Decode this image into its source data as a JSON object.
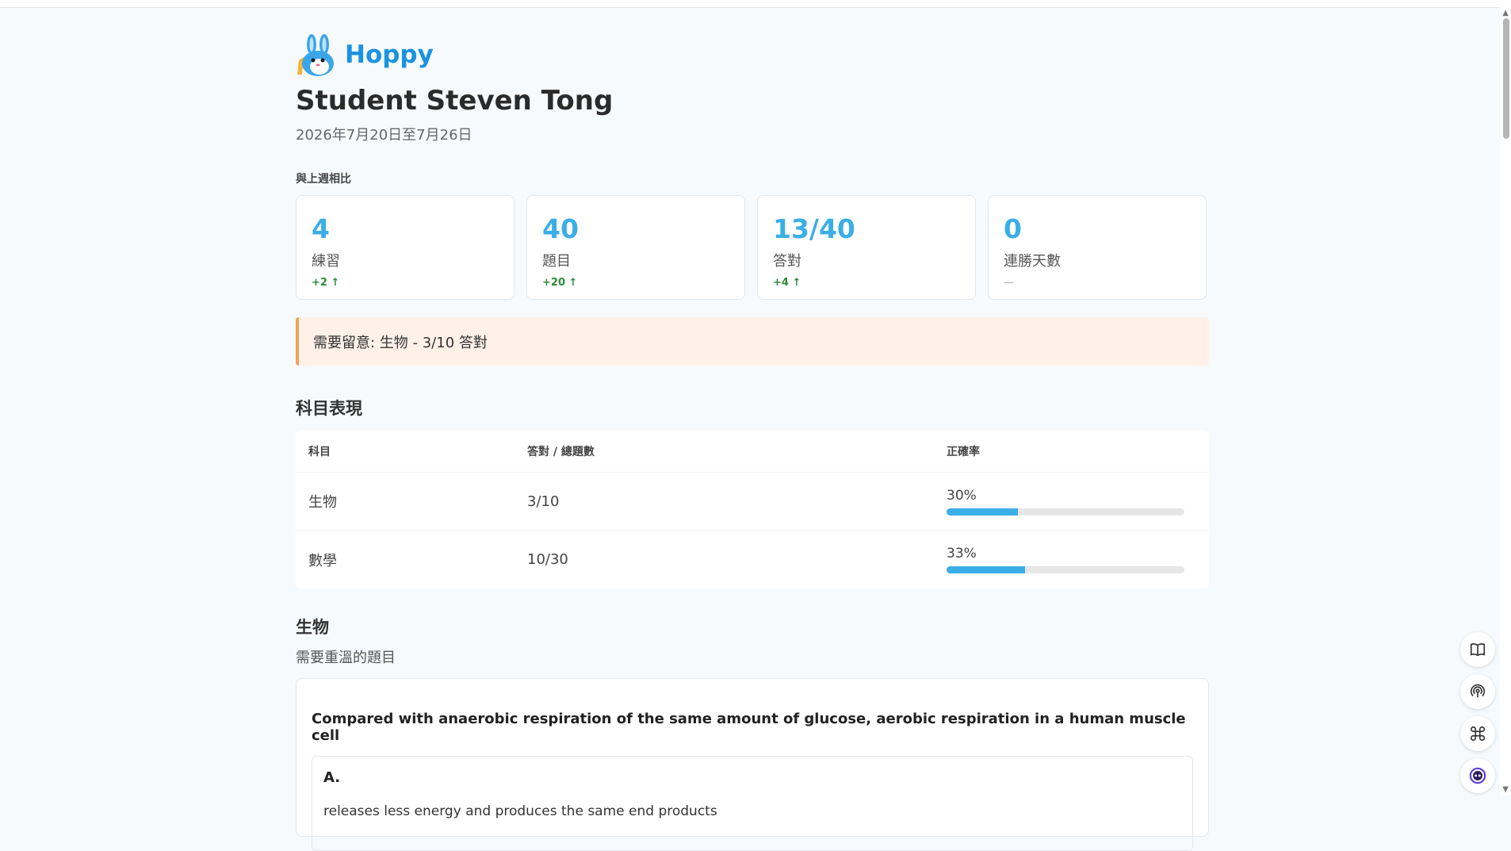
{
  "brand": {
    "name": "Hoppy"
  },
  "report": {
    "title": "Student Steven Tong",
    "date_range": "2026年7月20日至7月26日",
    "compare_label": "與上週相比"
  },
  "stats": [
    {
      "value": "4",
      "label": "練習",
      "delta": "+2 ↑"
    },
    {
      "value": "40",
      "label": "題目",
      "delta": "+20 ↑"
    },
    {
      "value": "13/40",
      "label": "答對",
      "delta": "+4 ↑"
    },
    {
      "value": "0",
      "label": "連勝天數",
      "delta": "—"
    }
  ],
  "alert": {
    "text": "需要留意: 生物 - 3/10 答對"
  },
  "performance": {
    "title": "科目表現",
    "headers": [
      "科目",
      "答對 / 總題數",
      "正確率"
    ],
    "rows": [
      {
        "subject": "生物",
        "score": "3/10",
        "percent_label": "30%",
        "percent": 30
      },
      {
        "subject": "數學",
        "score": "10/30",
        "percent_label": "33%",
        "percent": 33
      }
    ],
    "bar_color": "#3aaee6"
  },
  "review": {
    "subject": "生物",
    "subtitle": "需要重溫的題目",
    "question": "Compared with anaerobic respiration of the same amount of glucose, aerobic respiration in a human muscle cell",
    "options": [
      {
        "letter": "A.",
        "text": "releases less energy and produces the same end products"
      }
    ]
  },
  "floating_buttons": [
    "book-icon",
    "podcast-icon",
    "command-icon",
    "assistant-icon"
  ],
  "colors": {
    "accent": "#3aaee6",
    "brand": "#1a93e0",
    "positive": "#2e8b3a",
    "alert_bg": "#fff1e7",
    "alert_border": "#f0a05a"
  }
}
